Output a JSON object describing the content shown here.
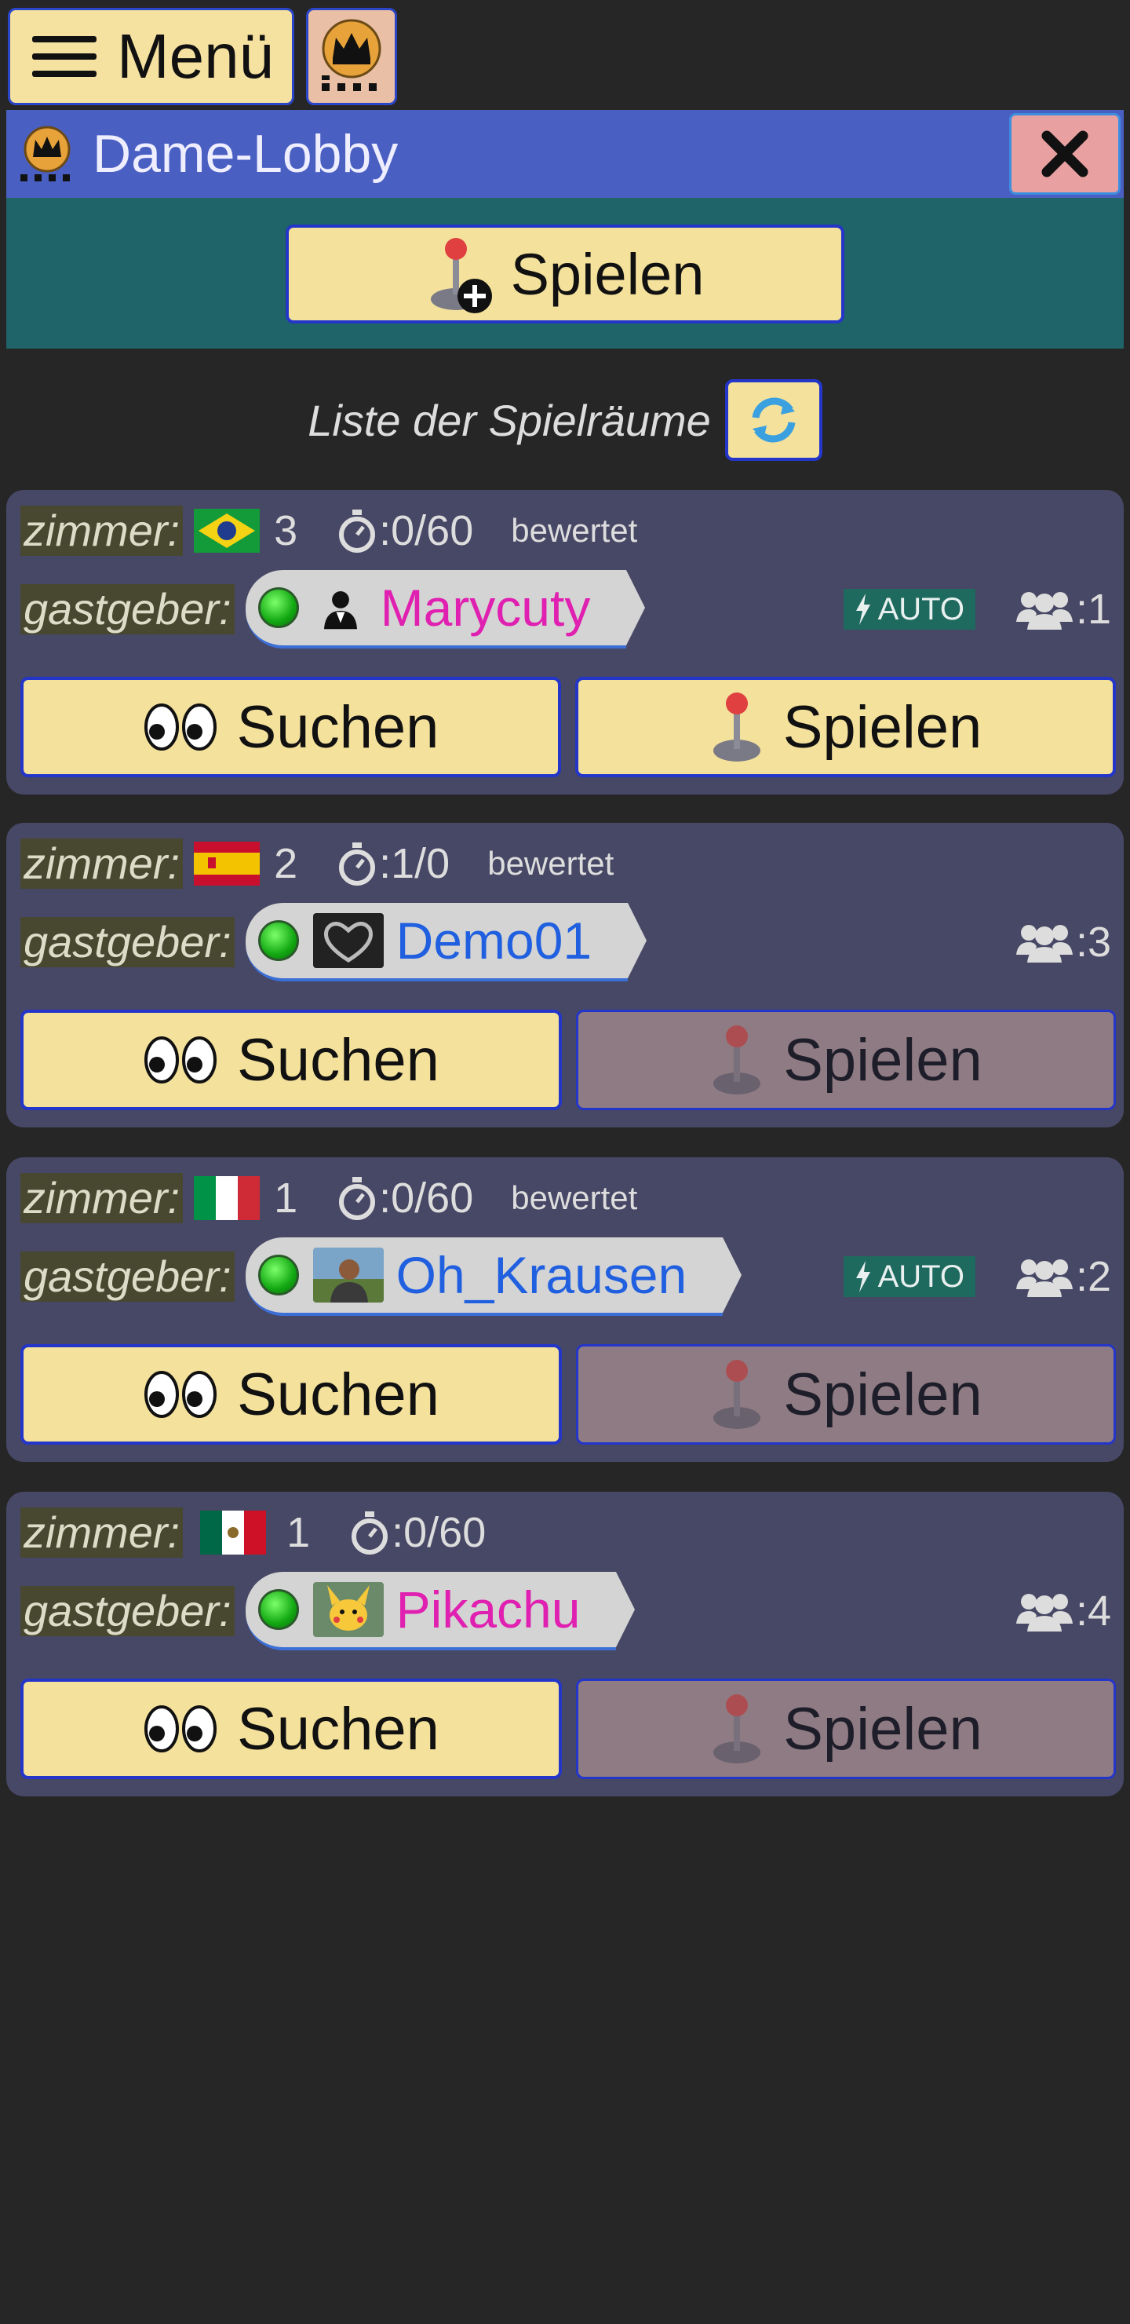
{
  "menu": {
    "label": "Menü"
  },
  "lobby": {
    "title": "Dame-Lobby",
    "play_label": "Spielen",
    "list_label": "Liste der Spielräume"
  },
  "labels": {
    "room": "zimmer:",
    "host": "gastgeber:",
    "search": "Suchen",
    "play": "Spielen",
    "rated": "bewertet",
    "auto": "AUTO"
  },
  "rooms": [
    {
      "flag": "brazil",
      "number": "3",
      "time": ":0/60",
      "rated": true,
      "host": "Marycuty",
      "host_color": "#e020b0",
      "auto": true,
      "players": ":1",
      "play_enabled": true
    },
    {
      "flag": "spain",
      "number": "2",
      "time": ":1/0",
      "rated": true,
      "host": "Demo01",
      "host_color": "#2060e0",
      "auto": false,
      "players": ":3",
      "play_enabled": false
    },
    {
      "flag": "italy",
      "number": "1",
      "time": ":0/60",
      "rated": true,
      "host": "Oh_Krausen",
      "host_color": "#2060e0",
      "auto": true,
      "players": ":2",
      "play_enabled": false
    },
    {
      "flag": "mexico",
      "number": "1",
      "time": ":0/60",
      "rated": false,
      "host": "Pikachu",
      "host_color": "#e020b0",
      "auto": false,
      "players": ":4",
      "play_enabled": false
    }
  ],
  "colors": {
    "accent_yellow": "#f3e19c",
    "header_blue": "#4a5fc2",
    "teal": "#1f6468",
    "card": "#474766"
  }
}
